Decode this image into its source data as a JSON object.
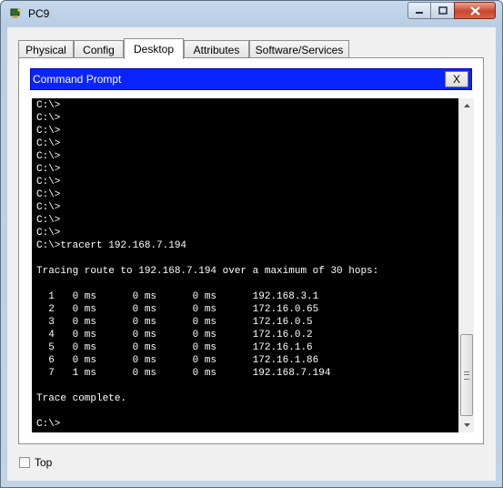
{
  "window": {
    "title": "PC9"
  },
  "tabs": [
    {
      "label": "Physical"
    },
    {
      "label": "Config"
    },
    {
      "label": "Desktop"
    },
    {
      "label": "Attributes"
    },
    {
      "label": "Software/Services"
    }
  ],
  "active_tab": "Desktop",
  "command_prompt": {
    "title": "Command Prompt",
    "close_label": "X",
    "lines": [
      "C:\\>",
      "C:\\>",
      "C:\\>",
      "C:\\>",
      "C:\\>",
      "C:\\>",
      "C:\\>",
      "C:\\>",
      "C:\\>",
      "C:\\>",
      "C:\\>",
      "C:\\>tracert 192.168.7.194",
      "",
      "Tracing route to 192.168.7.194 over a maximum of 30 hops:",
      "",
      "  1   0 ms      0 ms      0 ms      192.168.3.1",
      "  2   0 ms      0 ms      0 ms      172.16.0.65",
      "  3   0 ms      0 ms      0 ms      172.16.0.5",
      "  4   0 ms      0 ms      0 ms      172.16.0.2",
      "  5   0 ms      0 ms      0 ms      172.16.1.6",
      "  6   0 ms      0 ms      0 ms      172.16.1.86",
      "  7   1 ms      0 ms      0 ms      192.168.7.194",
      "",
      "Trace complete.",
      "",
      "C:\\>"
    ]
  },
  "footer": {
    "top_label": "Top",
    "top_checked": false
  },
  "icons": {
    "app": "packet-tracer-pc-icon",
    "minimize": "minimize-icon",
    "maximize": "maximize-icon",
    "close": "close-icon",
    "scroll_up": "scroll-up-arrow-icon",
    "scroll_down": "scroll-down-arrow-icon"
  }
}
